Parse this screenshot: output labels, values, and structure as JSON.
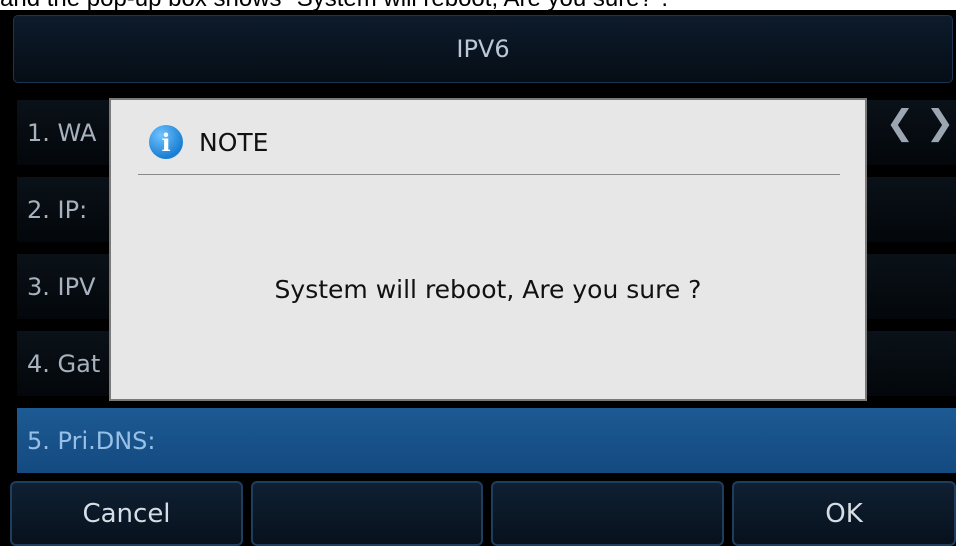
{
  "caption": "and the pop-up box shows \"System will reboot, Are you sure?\".",
  "screen": {
    "title": "IPV6",
    "rows": [
      {
        "label": "1. WA"
      },
      {
        "label": "2. IP:"
      },
      {
        "label": "3. IPV"
      },
      {
        "label": "4. Gat"
      },
      {
        "label": "5. Pri.DNS:",
        "selected": true
      }
    ],
    "nav": {
      "prev": "❮",
      "next": "❯"
    },
    "softkeys": [
      {
        "label": "Cancel"
      },
      {
        "label": ""
      },
      {
        "label": ""
      },
      {
        "label": "OK"
      }
    ]
  },
  "dialog": {
    "icon": "info-icon",
    "icon_glyph": "i",
    "title": "NOTE",
    "message": "System will reboot, Are you sure ?"
  },
  "colors": {
    "selected_row": "#1d5a93",
    "dialog_bg": "#e7e7e7",
    "info_icon": "#1a7fd4"
  }
}
